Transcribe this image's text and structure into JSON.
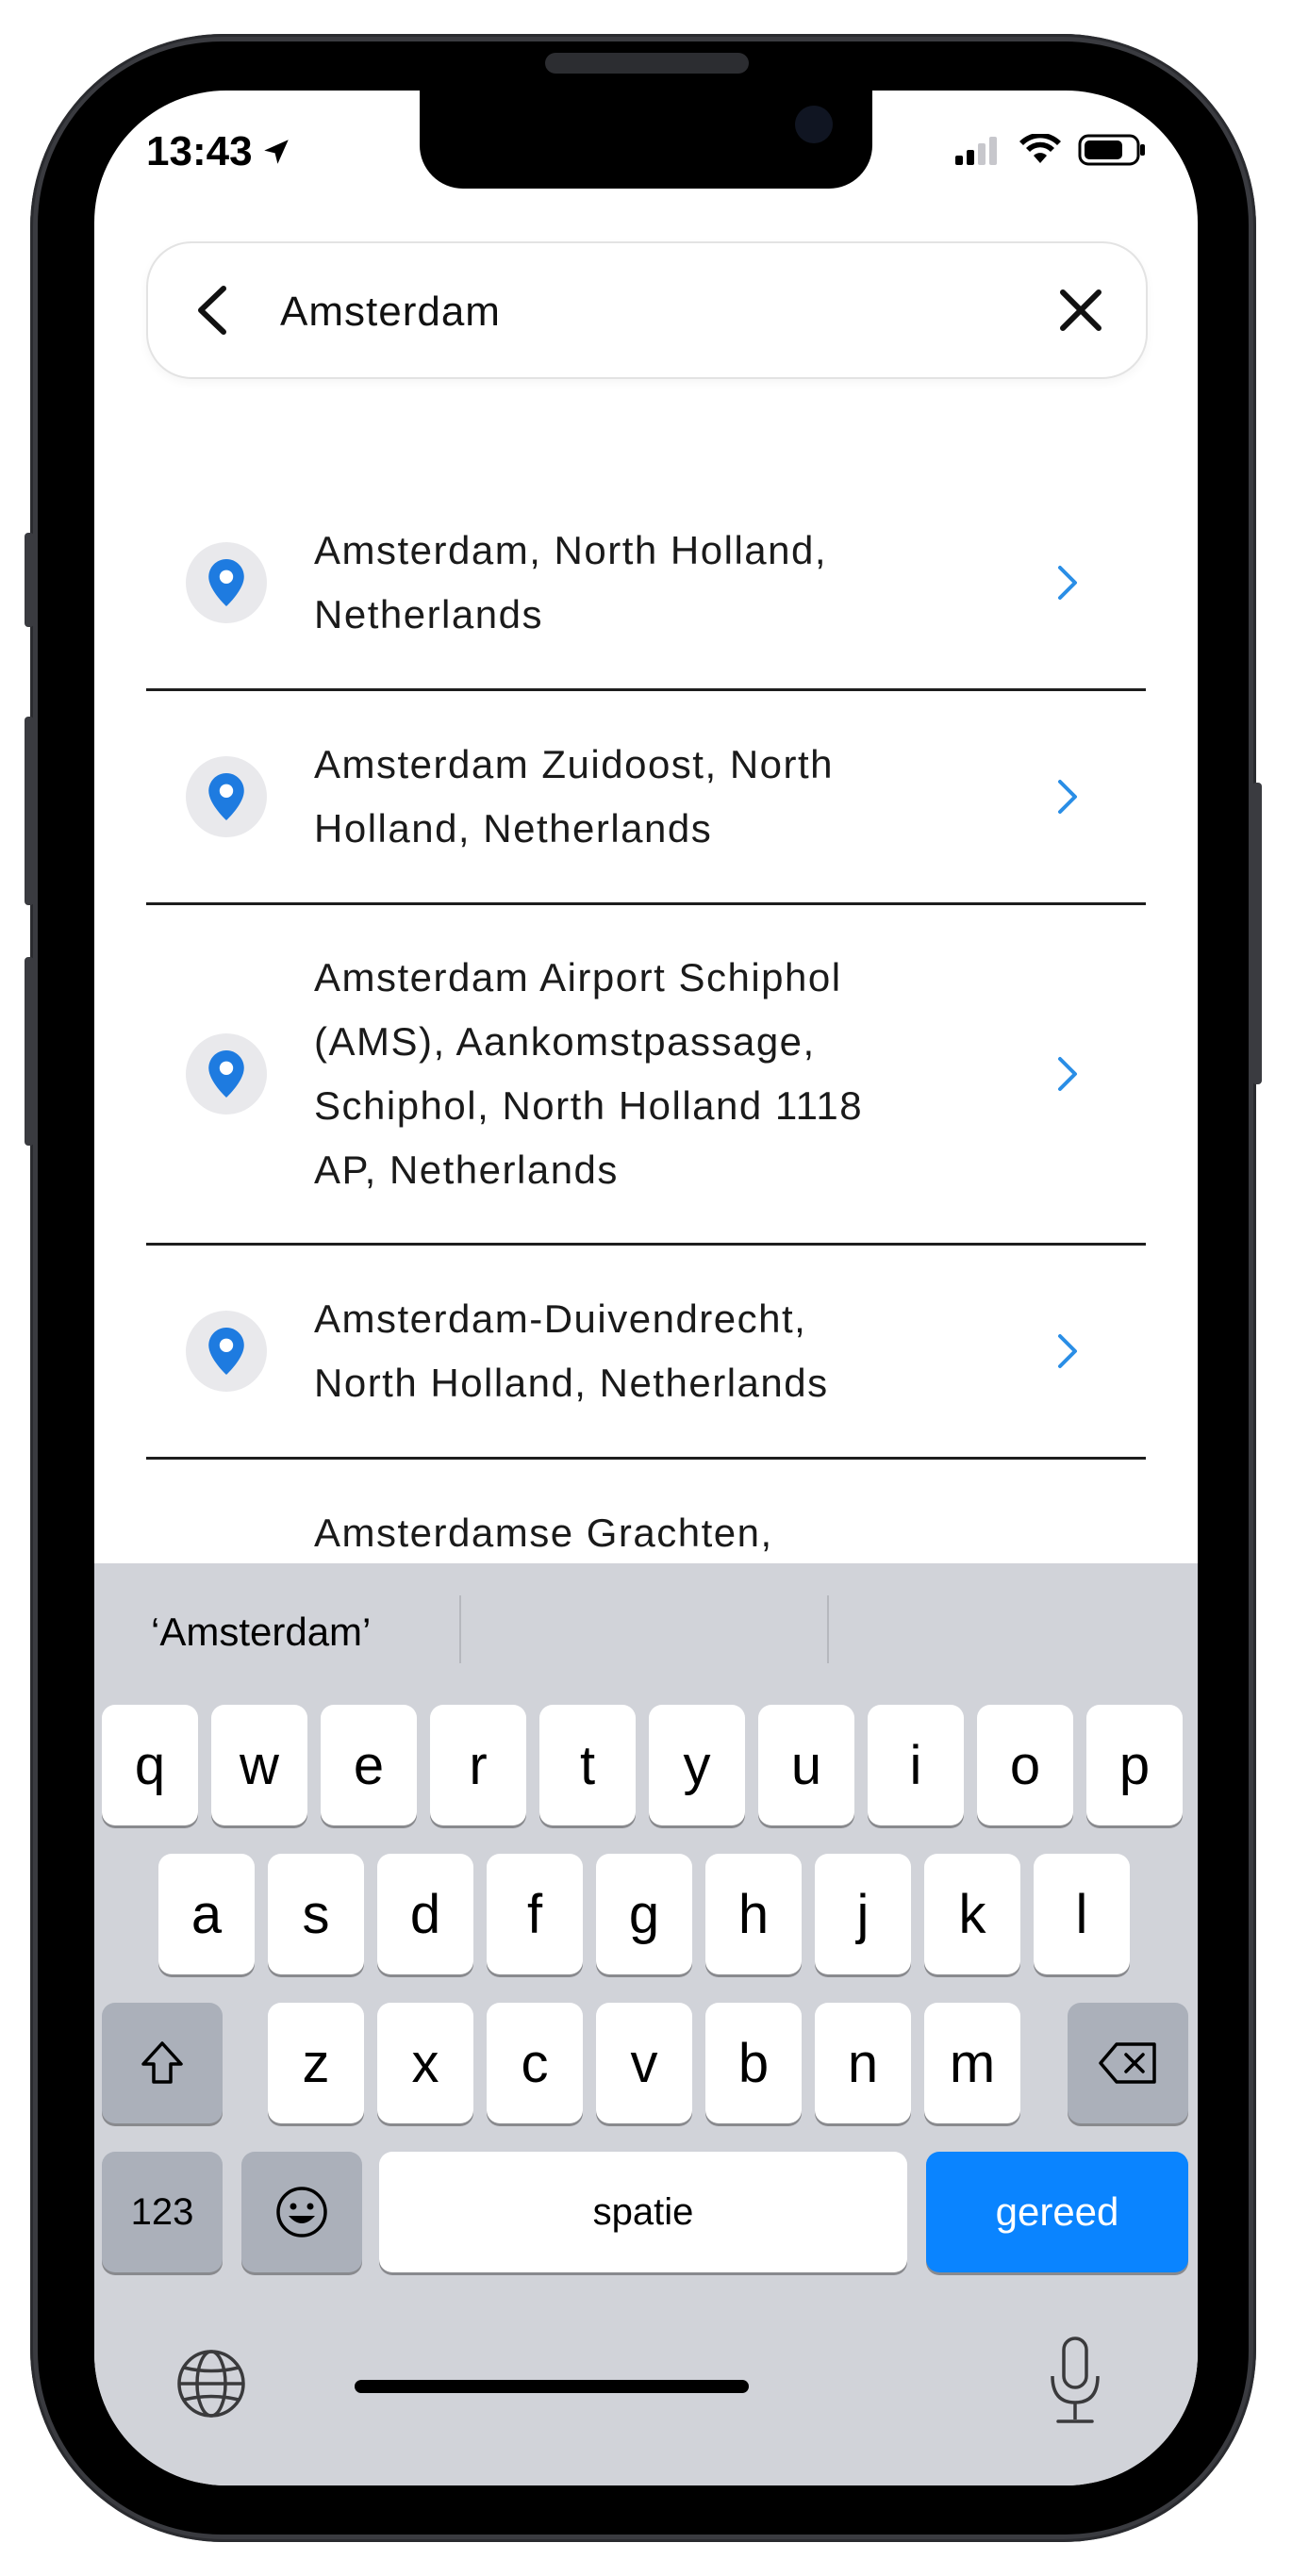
{
  "status": {
    "time": "13:43"
  },
  "search": {
    "value": "Amsterdam"
  },
  "results": [
    {
      "lines": [
        "Amsterdam, North Holland,",
        "Netherlands"
      ]
    },
    {
      "lines": [
        "Amsterdam Zuidoost, North",
        "Holland, Netherlands"
      ]
    },
    {
      "lines": [
        "Amsterdam Airport Schiphol",
        "(AMS), Aankomstpassage,",
        "Schiphol, North Holland 1118",
        "AP, Netherlands"
      ]
    },
    {
      "lines": [
        "Amsterdam-Duivendrecht,",
        "North Holland, Netherlands"
      ]
    },
    {
      "lines": [
        "Amsterdamse Grachten,"
      ]
    }
  ],
  "keyboard": {
    "suggestion": "‘Amsterdam’",
    "row1": [
      "q",
      "w",
      "e",
      "r",
      "t",
      "y",
      "u",
      "i",
      "o",
      "p"
    ],
    "row2": [
      "a",
      "s",
      "d",
      "f",
      "g",
      "h",
      "j",
      "k",
      "l"
    ],
    "row3": [
      "z",
      "x",
      "c",
      "v",
      "b",
      "n",
      "m"
    ],
    "numbers_label": "123",
    "space_label": "spatie",
    "done_label": "gereed"
  },
  "colors": {
    "accent": "#0a84ff",
    "pin": "#1e7be0",
    "chevron": "#2a8ee6"
  }
}
